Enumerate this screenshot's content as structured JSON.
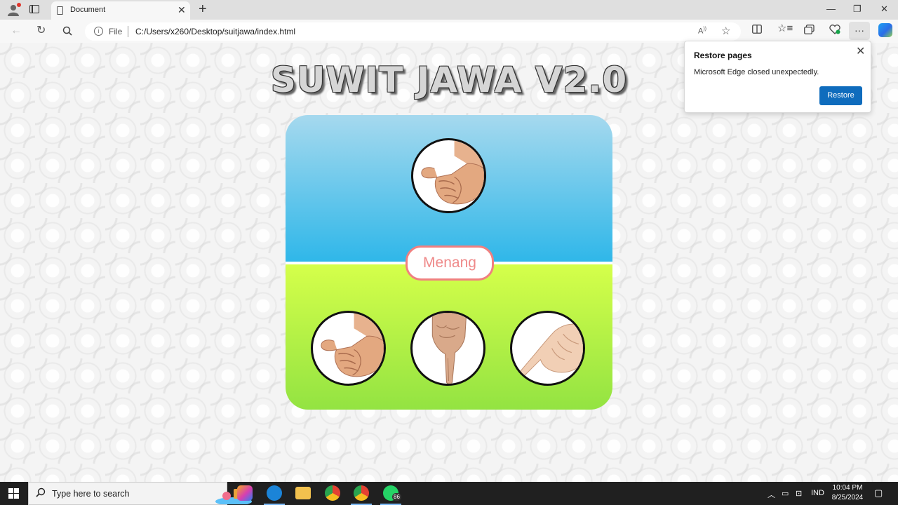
{
  "browser": {
    "tab_title": "Document",
    "tab_close_glyph": "✕",
    "new_tab_glyph": "+",
    "window_controls": {
      "minimize": "—",
      "maximize": "❐",
      "close": "✕"
    },
    "address": {
      "scheme_label": "File",
      "url": "C:/Users/x260/Desktop/suitjawa/index.html"
    },
    "icons": [
      "profile-icon",
      "tab-actions-icon",
      "back-icon",
      "refresh-icon",
      "search-icon",
      "info-icon",
      "read-aloud-icon",
      "favorite-star-icon",
      "split-screen-icon",
      "favorites-icon",
      "collections-icon",
      "browser-essentials-icon",
      "more-icon",
      "copilot-icon"
    ]
  },
  "popup": {
    "title": "Restore pages",
    "message": "Microsoft Edge closed unexpectedly.",
    "button_label": "Restore",
    "close_glyph": "✕"
  },
  "game": {
    "title": "SUWIT JAWA V2.0",
    "result": "Menang",
    "computer_choice": "gajah",
    "player_choices": [
      "gajah",
      "orang",
      "semut"
    ],
    "colors": {
      "top": "#2fb7e9",
      "bottom": "#93e342",
      "badge_border": "#f08080"
    }
  },
  "taskbar": {
    "search_placeholder": "Type here to search",
    "whatsapp_badge": "86",
    "language": "IND",
    "time": "10:04 PM",
    "date": "8/25/2024"
  }
}
